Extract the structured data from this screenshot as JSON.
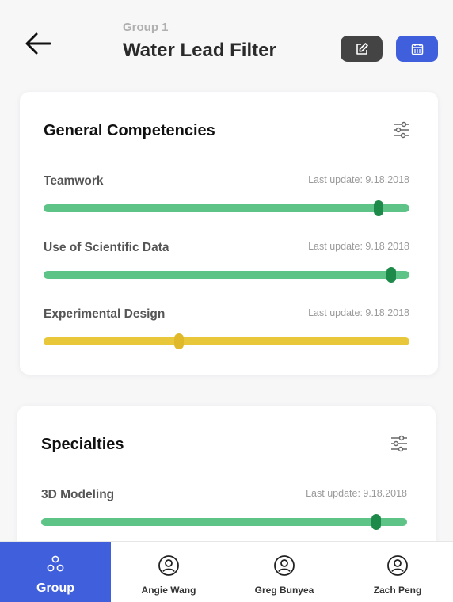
{
  "header": {
    "group_label": "Group 1",
    "title": "Water Lead Filter",
    "back_icon": "arrow-left-icon",
    "edit_icon": "edit-icon",
    "calendar_icon": "calendar-icon",
    "colors": {
      "edit_button": "#444444",
      "calendar_button": "#3f5fdc"
    }
  },
  "general": {
    "title": "General Competencies",
    "filter_icon": "sliders-icon",
    "items": [
      {
        "name": "Teamwork",
        "date": "Last update: 9.18.2018",
        "level": 0.915,
        "color": "#5dc386"
      },
      {
        "name": "Use of Scientific Data",
        "date": "Last update: 9.18.2018",
        "level": 0.95,
        "color": "#5dc386"
      },
      {
        "name": "Experimental Design",
        "date": "Last update: 9.18.2018",
        "level": 0.37,
        "color": "#e8c73a"
      }
    ]
  },
  "specialties": {
    "title": "Specialties",
    "filter_icon": "sliders-icon",
    "items": [
      {
        "name": "3D Modeling",
        "date": "Last update: 9.18.2018",
        "level": 0.915,
        "color": "#5dc386"
      }
    ]
  },
  "nav": {
    "items": [
      {
        "label": "Group",
        "icon": "group-icon",
        "active": true
      },
      {
        "label": "Angie Wang",
        "icon": "user-icon",
        "active": false
      },
      {
        "label": "Greg Bunyea",
        "icon": "user-icon",
        "active": false
      },
      {
        "label": "Zach Peng",
        "icon": "user-icon",
        "active": false
      }
    ],
    "active_color": "#3f5fdc"
  }
}
